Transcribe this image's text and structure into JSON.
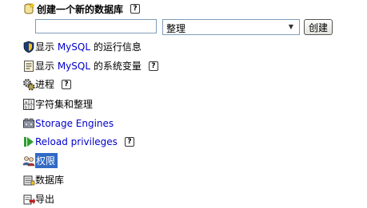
{
  "create_db": {
    "title": "创建一个新的数据库",
    "name_value": "",
    "collation_value": "整理",
    "create_button": "创建"
  },
  "menu": [
    {
      "label_prefix": "显示 ",
      "label_mysql": "MySQL",
      "label_suffix": " 的运行信息",
      "icon": "status-icon"
    },
    {
      "label_prefix": "显示 ",
      "label_mysql": "MySQL",
      "label_suffix": " 的系统变量",
      "icon": "variables-icon",
      "help": true
    },
    {
      "label": "进程",
      "icon": "processes-icon",
      "help": true
    },
    {
      "label": "字符集和整理",
      "icon": "charsets-icon"
    },
    {
      "label": "Storage Engines",
      "icon": "engines-icon"
    },
    {
      "label": "Reload privileges",
      "icon": "reload-icon",
      "help": true
    },
    {
      "label": "权限",
      "icon": "privileges-icon",
      "selected": true
    },
    {
      "label": "数据库",
      "icon": "databases-icon"
    },
    {
      "label": "导出",
      "icon": "export-icon"
    }
  ],
  "help_glyph": "?"
}
